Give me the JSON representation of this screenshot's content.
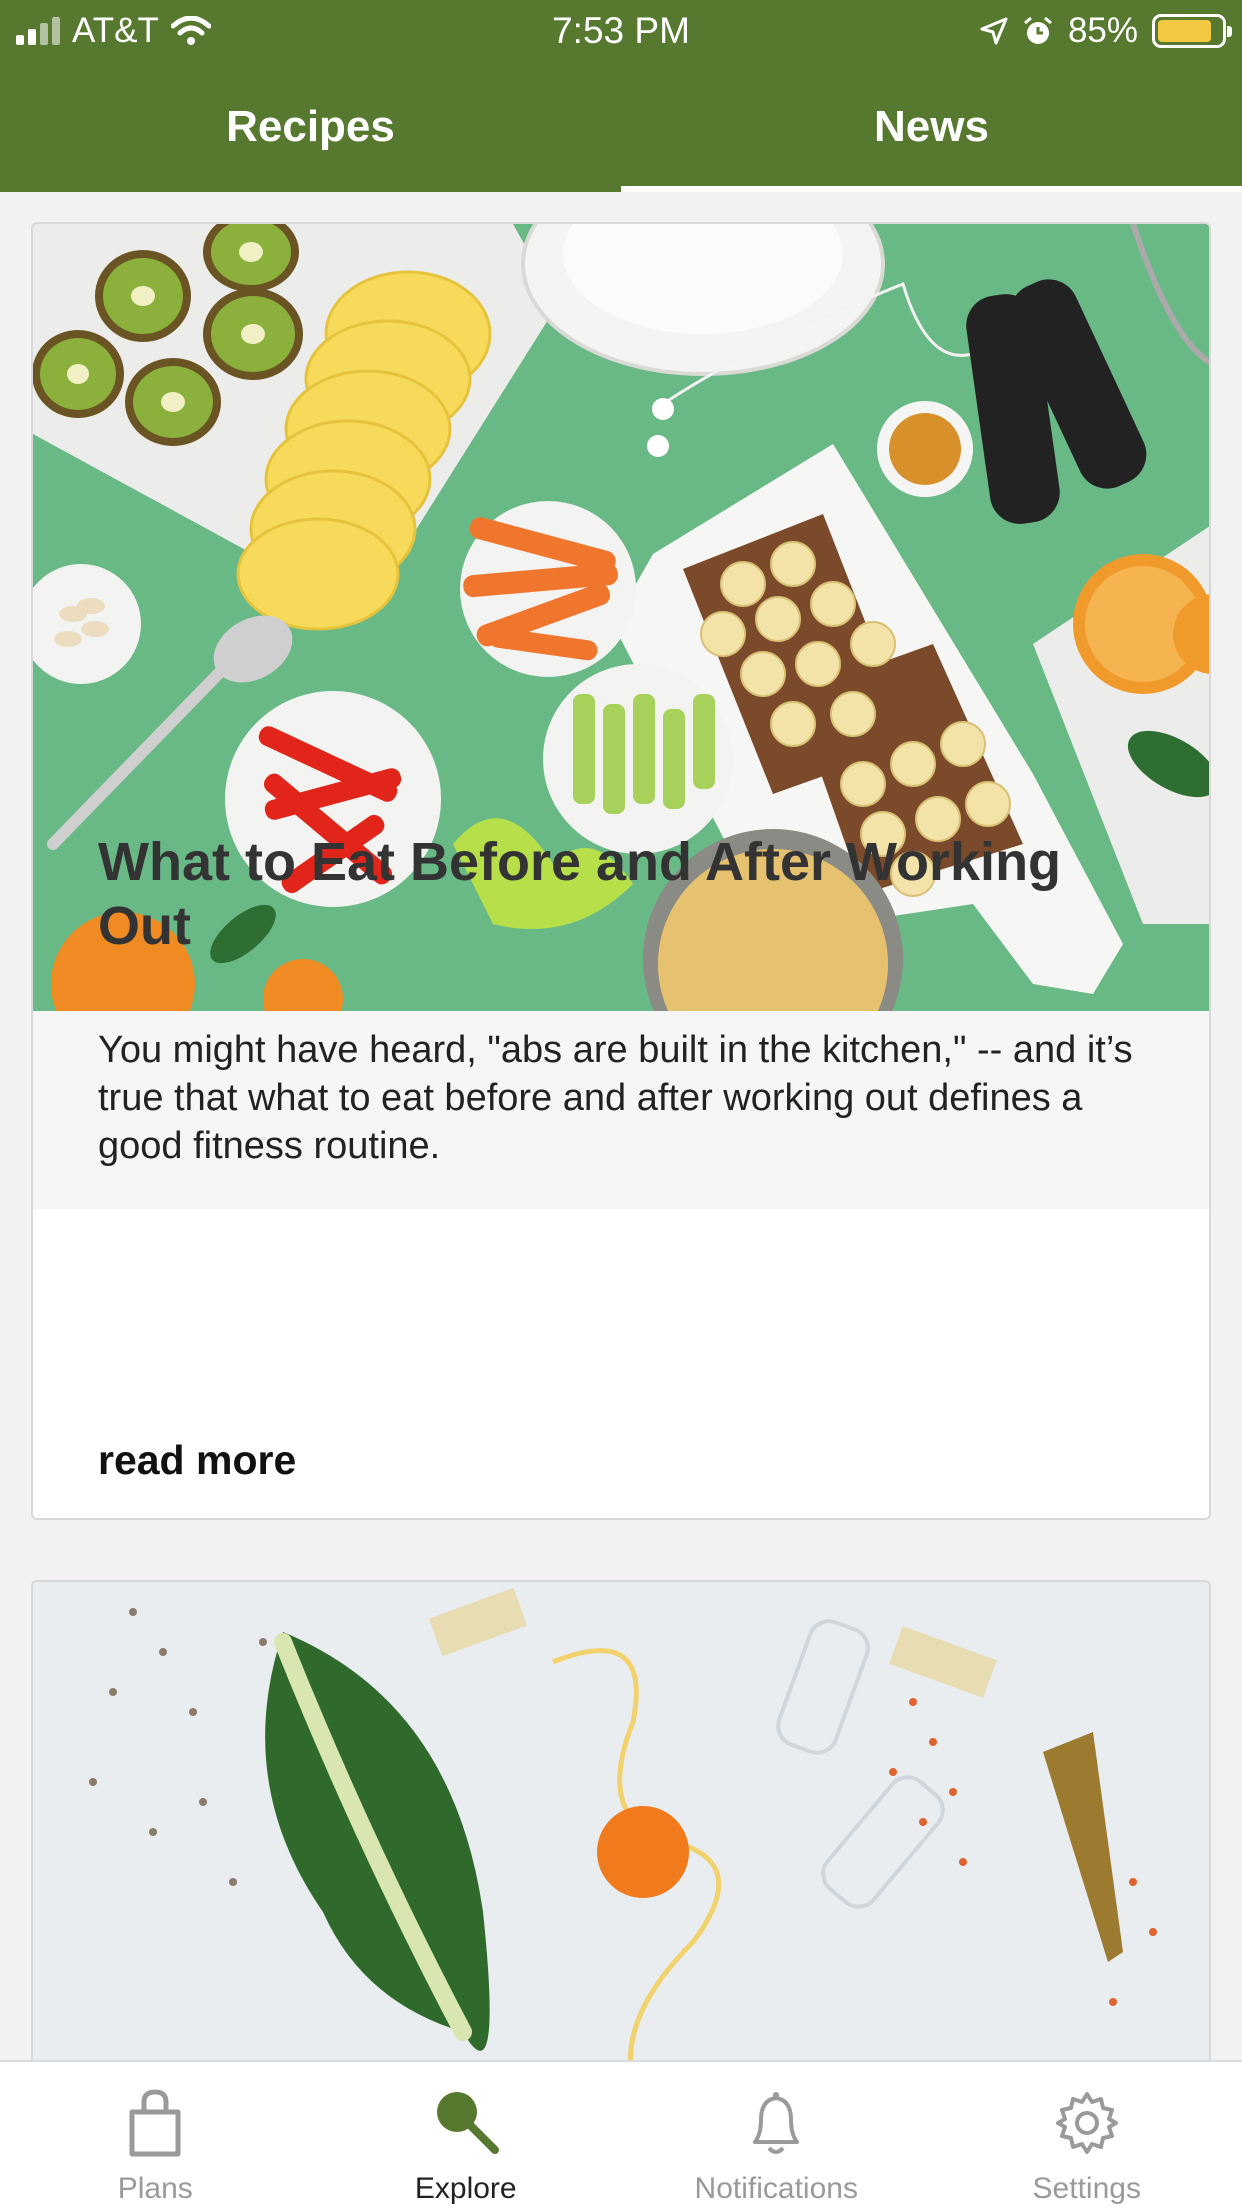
{
  "status_bar": {
    "carrier": "AT&T",
    "time": "7:53 PM",
    "battery": "85%",
    "battery_level": 0.85,
    "icons": [
      "signal-icon",
      "wifi-icon",
      "location-arrow-icon",
      "alarm-icon",
      "battery-icon"
    ]
  },
  "top_tabs": [
    {
      "label": "Recipes",
      "active": false
    },
    {
      "label": "News",
      "active": true
    }
  ],
  "articles": [
    {
      "title": "What to Eat Before and After Working Out",
      "excerpt": "You might have heard, \"abs are built in the kitchen,\" -- and it’s true that what to eat before and after working out defines a good fitness routine.",
      "read_more": "read more",
      "image_alt": "food spread"
    },
    {
      "image_alt": "party table"
    }
  ],
  "tab_bar": [
    {
      "label": "Plans",
      "icon": "shopping-bag-icon",
      "active": false
    },
    {
      "label": "Explore",
      "icon": "search-icon",
      "active": true
    },
    {
      "label": "Notifications",
      "icon": "bell-icon",
      "active": false
    },
    {
      "label": "Settings",
      "icon": "gear-icon",
      "active": false
    }
  ],
  "colors": {
    "header": "#56782f",
    "tab_active_icon": "#56782f",
    "tab_inactive": "#9a9a9a",
    "battery": "#f2c940"
  }
}
